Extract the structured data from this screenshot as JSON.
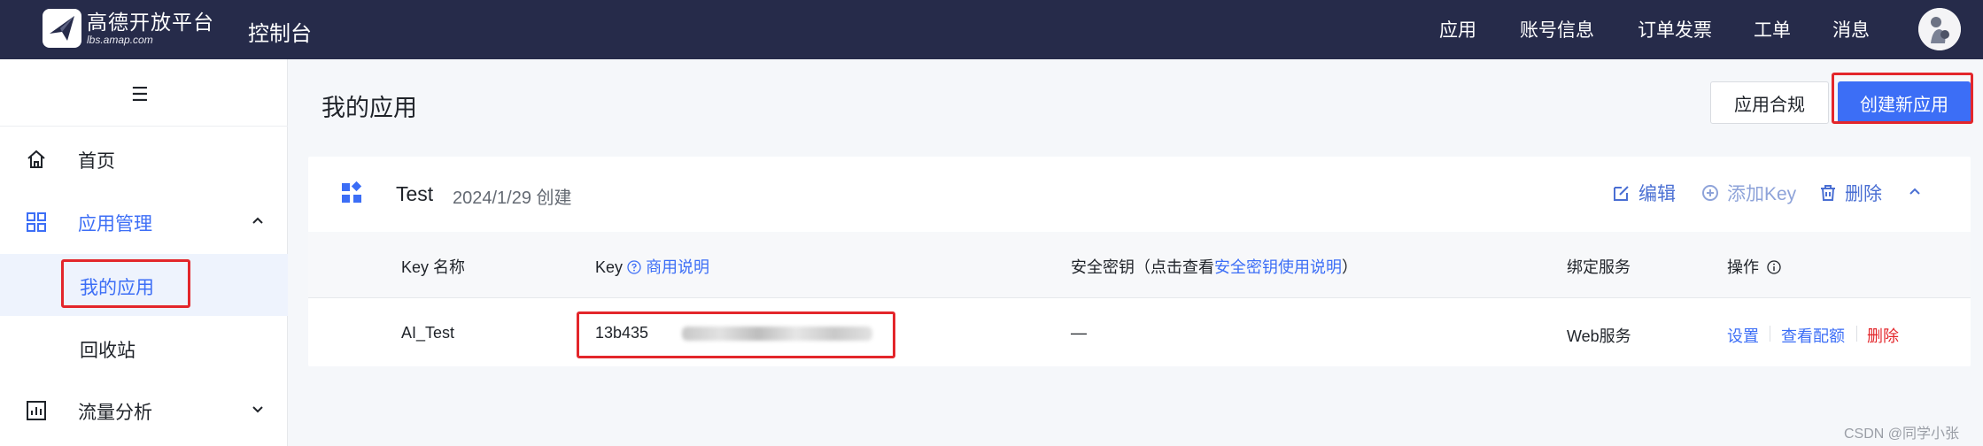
{
  "topbar": {
    "brand_cn": "高德开放平台",
    "brand_en": "lbs.amap.com",
    "console_title": "控制台",
    "nav": [
      "应用",
      "账号信息",
      "订单发票",
      "工单",
      "消息"
    ]
  },
  "sidebar": {
    "toggle_icon": "☰",
    "items": [
      {
        "label": "首页",
        "icon": "home-icon"
      },
      {
        "label": "应用管理",
        "icon": "grid-icon"
      },
      {
        "label": "我的应用"
      },
      {
        "label": "回收站"
      },
      {
        "label": "流量分析",
        "icon": "chart-icon"
      }
    ]
  },
  "main": {
    "page_title": "我的应用",
    "compliance_button": "应用合规",
    "create_button": "创建新应用"
  },
  "app_card": {
    "name": "Test",
    "created": "2024/1/29 创建",
    "actions": {
      "edit": "编辑",
      "add_key": "添加Key",
      "delete": "删除"
    },
    "table": {
      "headers": {
        "key_name": "Key 名称",
        "key": "Key",
        "key_link": "商用说明",
        "secret_prefix": "安全密钥（点击查看",
        "secret_link": "安全密钥使用说明",
        "secret_suffix": "）",
        "bound_service": "绑定服务",
        "operations": "操作"
      },
      "rows": [
        {
          "key_name": "AI_Test",
          "key_visible": "13b435",
          "secret": "—",
          "service": "Web服务",
          "ops": {
            "settings": "设置",
            "quota": "查看配额",
            "delete": "删除"
          }
        }
      ]
    }
  },
  "colors": {
    "topbar_bg": "#262b4a",
    "primary": "#3c6ef6",
    "link": "#4a6fd3",
    "danger": "#e3262b",
    "annotation_red": "#e3262b"
  },
  "watermark": "CSDN @同学小张"
}
